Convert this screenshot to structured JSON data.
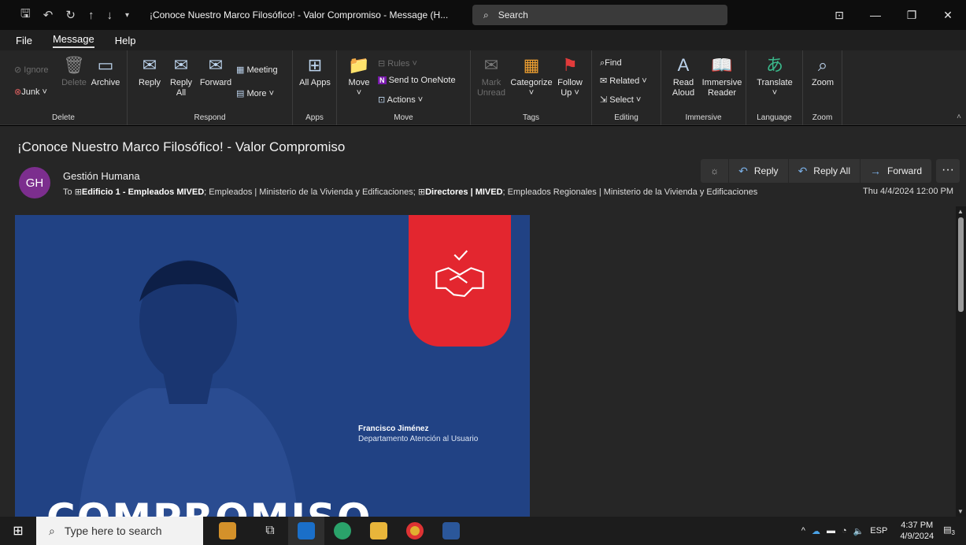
{
  "window": {
    "title": "¡Conoce Nuestro Marco Filosófico! - Valor Compromiso  -  Message (H...",
    "search_placeholder": "Search"
  },
  "menu": [
    "File",
    "Message",
    "Help"
  ],
  "ribbon": {
    "delete": {
      "label": "Delete",
      "ignore": "Ignore",
      "junk": "Junk",
      "delete": "Delete",
      "archive": "Archive"
    },
    "respond": {
      "label": "Respond",
      "reply": "Reply",
      "reply_all": "Reply All",
      "forward": "Forward",
      "meeting": "Meeting",
      "more": "More"
    },
    "apps": {
      "label": "Apps",
      "all_apps": "All Apps"
    },
    "move": {
      "label": "Move",
      "move": "Move",
      "rules": "Rules",
      "onenote": "Send to OneNote",
      "actions": "Actions"
    },
    "tags": {
      "label": "Tags",
      "mark_unread": "Mark Unread",
      "categorize": "Categorize",
      "follow_up": "Follow Up"
    },
    "editing": {
      "label": "Editing",
      "find": "Find",
      "related": "Related",
      "select": "Select"
    },
    "immersive": {
      "label": "Immersive",
      "read_aloud": "Read Aloud",
      "immersive_reader": "Immersive Reader"
    },
    "language": {
      "label": "Language",
      "translate": "Translate"
    },
    "zoom": {
      "label": "Zoom",
      "zoom": "Zoom"
    }
  },
  "message": {
    "subject": "¡Conoce Nuestro Marco Filosófico! - Valor Compromiso",
    "avatar_initials": "GH",
    "sender": "Gestión Humana",
    "to_label": "To",
    "recipient_1": "Edificio 1 - Empleados MIVED",
    "recipient_2": "Empleados | Ministerio de la Vivienda y Edificaciones;",
    "recipient_3": "Directores | MIVED",
    "recipient_4": "Empleados Regionales | Ministerio de la Vivienda y Edificaciones",
    "date": "Thu 4/4/2024 12:00 PM",
    "reply": "Reply",
    "reply_all": "Reply All",
    "forward": "Forward"
  },
  "banner": {
    "person_name": "Francisco Jiménez",
    "person_dept": "Departamento Atención al Usuario",
    "big_word": "COMPROMISO"
  },
  "taskbar": {
    "search_placeholder": "Type here to search",
    "language": "ESP",
    "time": "4:37 PM",
    "date": "4/9/2024",
    "notifications": "3"
  },
  "colors": {
    "accent": "#7ab0e8",
    "banner": "#214284",
    "red": "#e3262f",
    "avatar": "#7c2e8e"
  }
}
